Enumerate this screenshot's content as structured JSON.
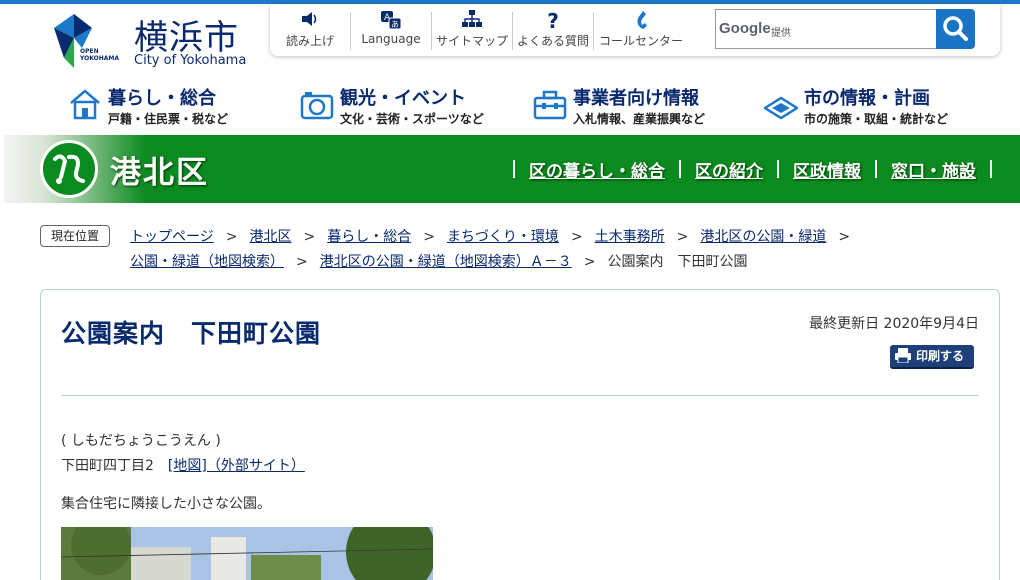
{
  "logo": {
    "open_mark": "OPEN\nYOKOHAMA",
    "title_jp": "横浜市",
    "title_en": "City of Yokohama"
  },
  "utility": {
    "items": [
      {
        "label": "読み上げ",
        "icon": "speaker-icon"
      },
      {
        "label": "Language",
        "icon": "language-icon"
      },
      {
        "label": "サイトマップ",
        "icon": "sitemap-icon"
      },
      {
        "label": "よくある質問",
        "icon": "question-icon"
      },
      {
        "label": "コールセンター",
        "icon": "phone-icon"
      }
    ],
    "search_brand": "Google",
    "search_provided": "提供"
  },
  "gnav": {
    "items": [
      {
        "title": "暮らし・総合",
        "sub": "戸籍・住民票・税など",
        "icon": "house-icon"
      },
      {
        "title": "観光・イベント",
        "sub": "文化・芸術・スポーツなど",
        "icon": "camera-icon"
      },
      {
        "title": "事業者向け情報",
        "sub": "入札情報、産業振興など",
        "icon": "toolbox-icon"
      },
      {
        "title": "市の情報・計画",
        "sub": "市の施策・取組・統計など",
        "icon": "diamond-icon"
      }
    ]
  },
  "banner": {
    "ward": "港北区",
    "links": [
      "区の暮らし・総合",
      "区の紹介",
      "区政情報",
      "窓口・施設"
    ]
  },
  "breadcrumb": {
    "label": "現在位置",
    "items": [
      "トップページ",
      "港北区",
      "暮らし・総合",
      "まちづくり・環境",
      "土木事務所",
      "港北区の公園・緑道",
      "公園・緑道（地図検索）",
      "港北区の公園・緑道（地図検索）Ａ－３"
    ],
    "current": "公園案内　下田町公園",
    "separator": ">"
  },
  "content": {
    "title": "公園案内　下田町公園",
    "updated": "最終更新日 2020年9月4日",
    "print_label": "印刷する",
    "reading": "( しもだちょうこうえん )",
    "address": "下田町四丁目2",
    "map_link": "[地図]（外部サイト）",
    "description": "集合住宅に隣接した小さな公園。"
  },
  "colors": {
    "navy": "#0a2a6e",
    "green": "#0a8a1f",
    "blue": "#1d78c9"
  }
}
